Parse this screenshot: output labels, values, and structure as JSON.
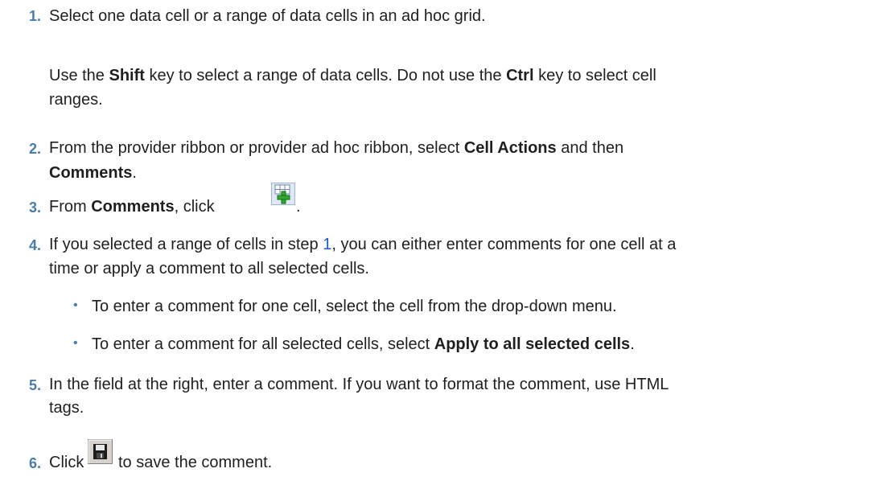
{
  "steps": [
    {
      "number": "1.",
      "text": "Select one data cell or a range of data cells in an ad hoc grid.",
      "para_a": "Use the ",
      "para_b": "Shift",
      "para_c": " key to select a range of data cells. Do not use the ",
      "para_d": "Ctrl",
      "para_e": " key to select cell",
      "para_f": "ranges."
    },
    {
      "number": "2.",
      "a": "From the provider ribbon or provider ad hoc ribbon, select ",
      "b": "Cell Actions",
      "c": " and then",
      "d": "Comments",
      "e": "."
    },
    {
      "number": "3.",
      "a": "From ",
      "b": "Comments",
      "c": ", click",
      "d": ".",
      "icon": "add-comment-icon"
    },
    {
      "number": "4.",
      "a": "If you selected a range of cells in step ",
      "link": "1",
      "b": ", you can either enter comments for one cell at a",
      "c": "time or apply a comment to all selected cells.",
      "bullet_glyph": "•",
      "bullets": [
        {
          "a": "To enter a comment for one cell, select the cell from the drop-down menu."
        },
        {
          "a": "To enter a comment for all selected cells, select ",
          "b": "Apply to all selected cells",
          "c": "."
        }
      ]
    },
    {
      "number": "5.",
      "a": "In the field at the right, enter a comment. If you want to format the comment, use HTML",
      "b": "tags."
    },
    {
      "number": "6.",
      "a": "Click",
      "b": "to save the comment.",
      "icon": "save-icon"
    }
  ],
  "colors": {
    "step_number": "#4a7ca8",
    "link": "#1a5bc4",
    "text": "#1f1f1f"
  }
}
